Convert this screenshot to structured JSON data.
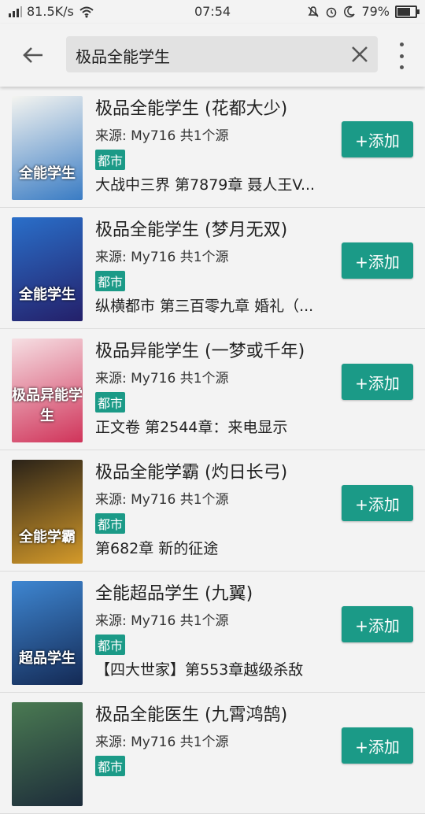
{
  "status_bar": {
    "net_speed": "81.5K/s",
    "time": "07:54",
    "battery": "79%",
    "battery_level": 0.79
  },
  "search": {
    "query": "极品全能学生"
  },
  "results": [
    {
      "title": "极品全能学生 (花都大少)",
      "source": "来源: My716 共1个源",
      "tag": "都市",
      "latest": "大战中三界 第7879章 聂人王V...",
      "add_label": "+添加",
      "cover_text": "全能学生",
      "cover_colors": [
        "#f4f4f0",
        "#3a7cc4"
      ]
    },
    {
      "title": "极品全能学生 (梦月无双)",
      "source": "来源: My716 共1个源",
      "tag": "都市",
      "latest": "纵横都市 第三百零九章 婚礼（...",
      "add_label": "+添加",
      "cover_text": "全能学生",
      "cover_colors": [
        "#2a6fc9",
        "#24206a"
      ]
    },
    {
      "title": "极品异能学生 (一梦或千年)",
      "source": "来源: My716 共1个源",
      "tag": "都市",
      "latest": "正文卷 第2544章：来电显示",
      "add_label": "+添加",
      "cover_text": "极品异能学生",
      "cover_colors": [
        "#f6dfe3",
        "#d0345a"
      ]
    },
    {
      "title": "极品全能学霸 (灼日长弓)",
      "source": "来源: My716 共1个源",
      "tag": "都市",
      "latest": "第682章 新的征途",
      "add_label": "+添加",
      "cover_text": "全能学霸",
      "cover_colors": [
        "#2a2218",
        "#d49a2a"
      ]
    },
    {
      "title": "全能超品学生 (九翼)",
      "source": "来源: My716 共1个源",
      "tag": "都市",
      "latest": "【四大世家】第553章越级杀敌",
      "add_label": "+添加",
      "cover_text": "超品学生",
      "cover_colors": [
        "#3e86d1",
        "#142a55"
      ]
    },
    {
      "title": "极品全能医生 (九霄鸿鹄)",
      "source": "来源: My716 共1个源",
      "tag": "都市",
      "latest": "",
      "add_label": "+添加",
      "cover_text": "",
      "cover_colors": [
        "#4a7a52",
        "#1d2c3a"
      ]
    }
  ]
}
